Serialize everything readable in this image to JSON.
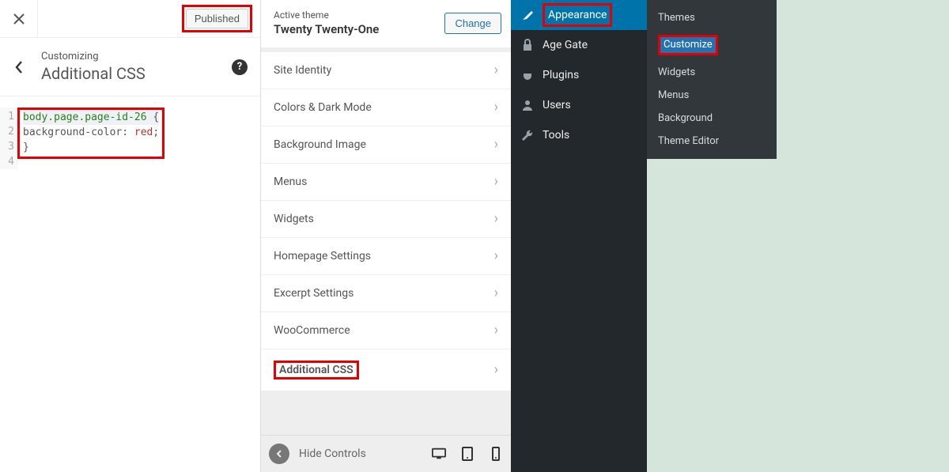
{
  "left_panel": {
    "published_label": "Published",
    "crumb_label": "Customizing",
    "crumb_title": "Additional CSS",
    "code": {
      "line1_selector": "body.page.page-id-26",
      "line1_brace": " {",
      "line2_prop": "background-color",
      "line2_colon": ": ",
      "line2_val": "red",
      "line2_semi": ";",
      "line3": "}"
    },
    "gutter": [
      "1",
      "2",
      "3",
      "4"
    ]
  },
  "mid_panel": {
    "theme_label": "Active theme",
    "theme_name": "Twenty Twenty-One",
    "change_btn": "Change",
    "sections": [
      "Site Identity",
      "Colors & Dark Mode",
      "Background Image",
      "Menus",
      "Widgets",
      "Homepage Settings",
      "Excerpt Settings",
      "WooCommerce",
      "Additional CSS"
    ],
    "hide_controls": "Hide Controls"
  },
  "admin": {
    "items": [
      {
        "label": "Appearance",
        "icon": "paintbrush",
        "active": true,
        "highlight": true
      },
      {
        "label": "Age Gate",
        "icon": "lock"
      },
      {
        "label": "Plugins",
        "icon": "plug"
      },
      {
        "label": "Users",
        "icon": "user"
      },
      {
        "label": "Tools",
        "icon": "wrench"
      }
    ]
  },
  "flyout": {
    "items": [
      "Themes",
      "Customize",
      "Widgets",
      "Menus",
      "Background",
      "Theme Editor"
    ],
    "highlight_idx": 1
  }
}
